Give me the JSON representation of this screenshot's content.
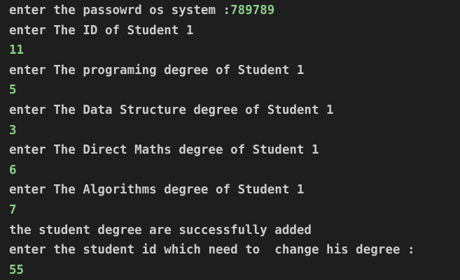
{
  "colors": {
    "background": "#1e1e1e",
    "output_text": "#cccccc",
    "user_input": "#89d185"
  },
  "terminal": {
    "lines": [
      {
        "prompt": "enter the passowrd os system :",
        "input": "789789"
      },
      {
        "prompt": "enter The ID of Student 1",
        "input": ""
      },
      {
        "prompt": "",
        "input": "11"
      },
      {
        "prompt": "enter The programing degree of Student 1",
        "input": ""
      },
      {
        "prompt": "",
        "input": "5"
      },
      {
        "prompt": "enter The Data Structure degree of Student 1",
        "input": ""
      },
      {
        "prompt": "",
        "input": "3"
      },
      {
        "prompt": "enter The Direct Maths degree of Student 1",
        "input": ""
      },
      {
        "prompt": "",
        "input": "6"
      },
      {
        "prompt": "enter The Algorithms degree of Student 1",
        "input": ""
      },
      {
        "prompt": "",
        "input": "7"
      },
      {
        "prompt": "the student degree are successfully added",
        "input": ""
      },
      {
        "prompt": "enter the student id which need to  change his degree :",
        "input": ""
      },
      {
        "prompt": "",
        "input": "55"
      }
    ]
  }
}
